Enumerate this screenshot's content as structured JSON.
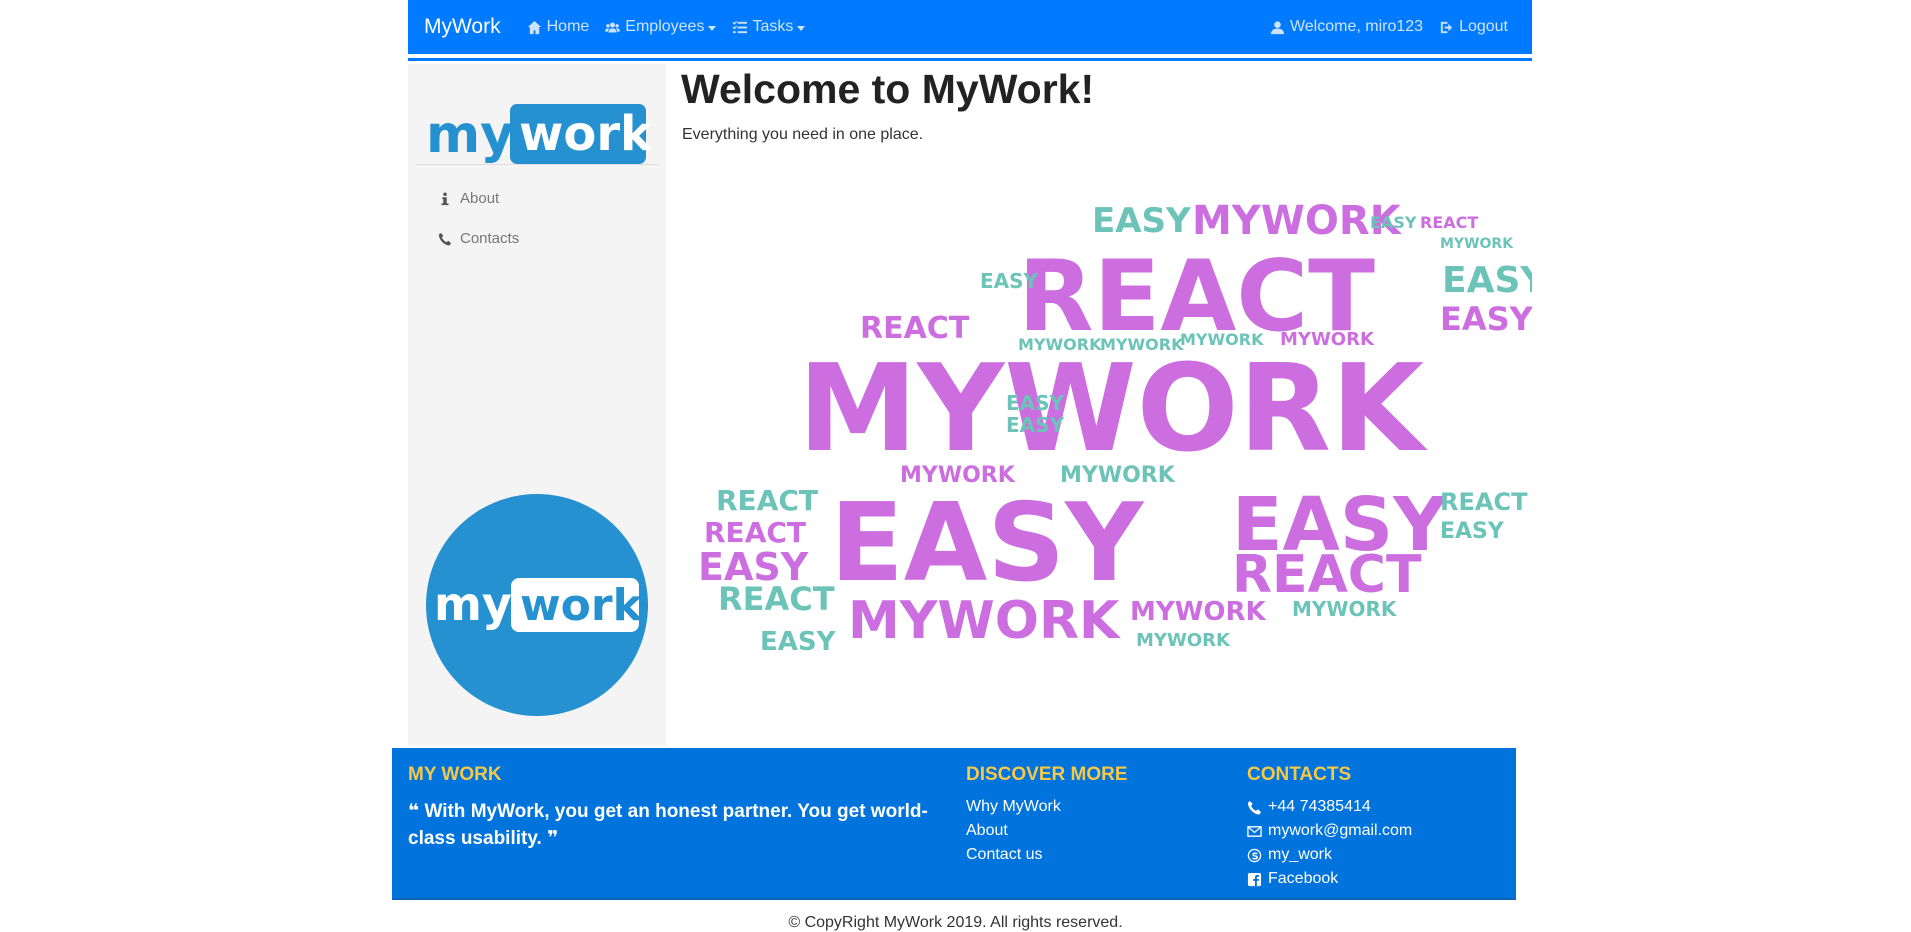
{
  "navbar": {
    "brand": "MyWork",
    "items": [
      {
        "label": "Home",
        "icon": "home-icon"
      },
      {
        "label": "Employees",
        "icon": "users-icon"
      },
      {
        "label": "Tasks",
        "icon": "tasks-icon"
      }
    ],
    "welcome": "Welcome, miro123",
    "logout": "Logout"
  },
  "sidebar": {
    "logo_my": "my",
    "logo_work": "work",
    "items": [
      {
        "label": "About",
        "icon": "info-icon"
      },
      {
        "label": "Contacts",
        "icon": "phone-icon"
      }
    ]
  },
  "main": {
    "title": "Welcome to MyWork!",
    "subtitle": "Everything you need in one place.",
    "wordcloud_words": [
      "REACT",
      "MYWORK",
      "EASY"
    ]
  },
  "footer": {
    "col1": {
      "heading": "MY WORK",
      "quote": "With MyWork, you get an honest partner. You get world-class usability."
    },
    "col2": {
      "heading": "DISCOVER MORE",
      "links": [
        "Why MyWork",
        "About",
        "Contact us"
      ]
    },
    "col3": {
      "heading": "CONTACTS",
      "phone": "+44 74385414",
      "email": "mywork@gmail.com",
      "skype": "my_work",
      "facebook": "Facebook"
    }
  },
  "copyright": "© CopyRight MyWork 2019. All rights reserved.",
  "colors": {
    "primary": "#007bff",
    "footer": "#0073dc",
    "accent": "#f7c846",
    "logo_blue": "#2591d0",
    "cloud_purple": "#cc6ee0",
    "cloud_teal": "#6cc3b8"
  }
}
